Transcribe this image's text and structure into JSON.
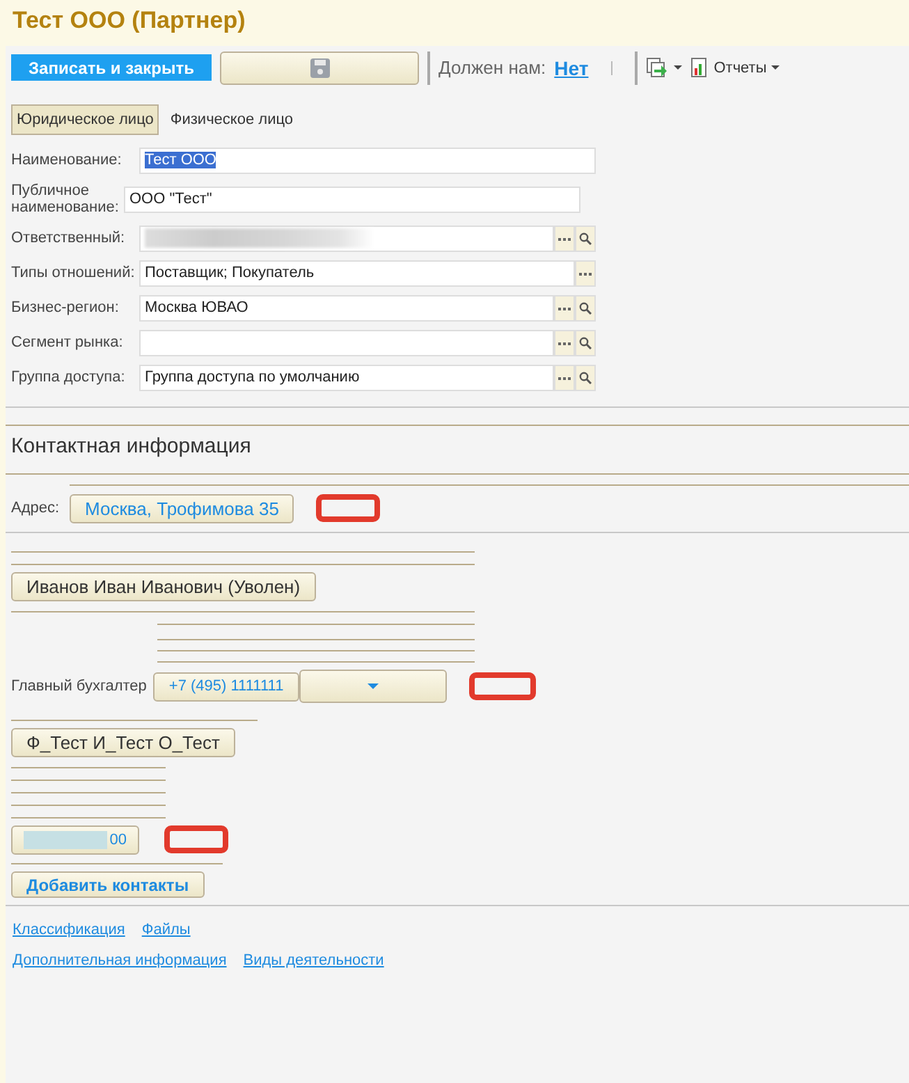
{
  "title": "Тест ООО (Партнер)",
  "toolbar": {
    "primary_button": "Записать и закрыть",
    "debt_label": "Должен нам:",
    "debt_value": "Нет",
    "reports_button": "Отчеты"
  },
  "tabs": [
    {
      "label": "Юридическое лицо",
      "selected": true
    },
    {
      "label": "Физическое лицо",
      "selected": false
    }
  ],
  "fields": [
    {
      "label": "Наименование:",
      "value": "Тест ООО",
      "highlighted": true,
      "redacted": false,
      "kind": "plain"
    },
    {
      "label": "Публичное наименование:",
      "value": "ООО \"Тест\"",
      "highlighted": false,
      "redacted": false,
      "kind": "wide"
    },
    {
      "label": "Ответственный:",
      "redacted": true,
      "kind": "choice_search"
    },
    {
      "label": "Типы отношений:",
      "value": "Поставщик; Покупатель",
      "highlighted": false,
      "redacted": false,
      "kind": "choice"
    },
    {
      "label": "Бизнес-регион:",
      "value": "Москва ЮВАО",
      "highlighted": false,
      "redacted": false,
      "kind": "choice_search"
    },
    {
      "label": "Сегмент рынка:",
      "redacted": false,
      "kind": "choice_search"
    },
    {
      "label": "Группа доступа:",
      "value": "Группа доступа по умолчанию",
      "highlighted": false,
      "redacted": false,
      "kind": "choice_search"
    }
  ],
  "contacts_title": "Контактная информация",
  "address": {
    "label": "Адрес:",
    "value": "Москва, Трофимова 35"
  },
  "persons": [
    {
      "name": "Иванов Иван Иванович (Уволен)",
      "role": "Главный бухгалтер",
      "phone": "+7 (495) 1111111"
    },
    {
      "name": "Ф_Тест И_Тест О_Тест",
      "phone": "00"
    }
  ],
  "add_contacts": "Добавить контакты",
  "links": [
    [
      "Классификация",
      "Файлы"
    ],
    [
      "Дополнительная информация",
      "Виды деятельности"
    ]
  ]
}
